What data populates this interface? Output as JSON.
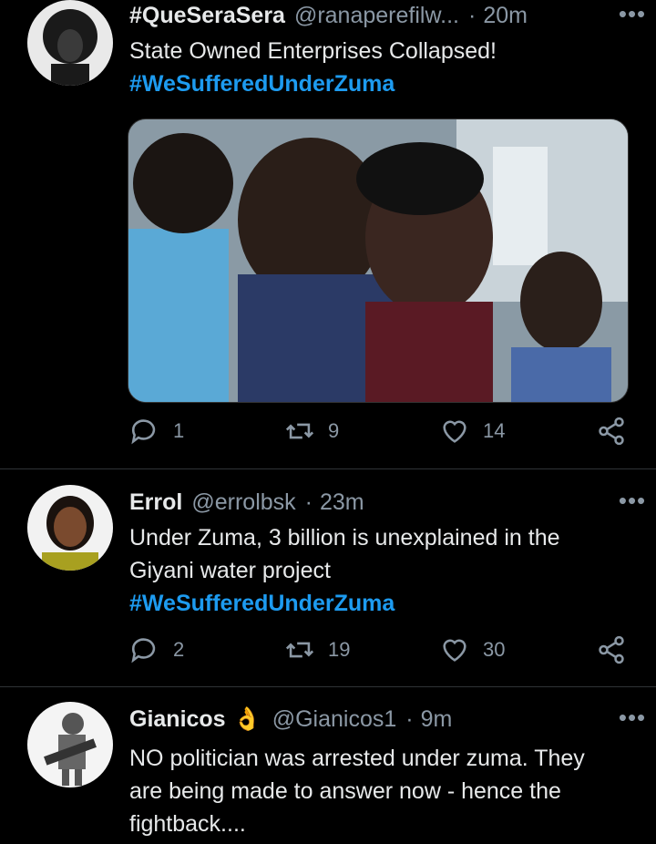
{
  "tweets": [
    {
      "name": "#QueSeraSera",
      "handle": "@ranaperefilw...",
      "time": "20m",
      "text": "State Owned Enterprises Collapsed!",
      "hashtag": "#WeSufferedUnderZuma",
      "replies": "1",
      "retweets": "9",
      "likes": "14",
      "media": "photo-mourning-women"
    },
    {
      "name": "Errol",
      "handle": "@errolbsk",
      "time": "23m",
      "text": "Under Zuma, 3 billion is unexplained in the Giyani water project",
      "hashtag": "#WeSufferedUnderZuma",
      "replies": "2",
      "retweets": "19",
      "likes": "30"
    },
    {
      "name": "Gianicos",
      "name_emoji": "👌",
      "handle": "@Gianicos1",
      "time": "9m",
      "text": "NO politician was arrested under zuma. They are being made to answer now - hence the fightback...."
    }
  ],
  "icons": {
    "more": "more-dots-icon",
    "reply": "reply-icon",
    "retweet": "retweet-icon",
    "like": "heart-icon",
    "share": "share-icon"
  },
  "colors": {
    "background": "#000000",
    "text": "#e7e9ea",
    "muted": "#8b98a5",
    "hashtag": "#1d9bf0",
    "divider": "#2f3336"
  }
}
